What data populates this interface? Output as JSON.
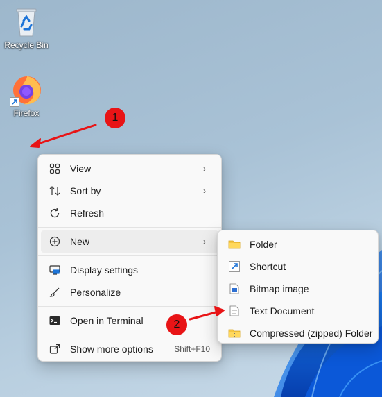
{
  "desktop": {
    "icons": [
      {
        "label": "Recycle Bin",
        "icon": "recycle-bin-icon"
      },
      {
        "label": "Firefox",
        "icon": "firefox-icon"
      }
    ]
  },
  "context_menu": {
    "items": [
      {
        "label": "View",
        "icon": "grid-view-icon",
        "has_submenu": true
      },
      {
        "label": "Sort by",
        "icon": "sort-icon",
        "has_submenu": true
      },
      {
        "label": "Refresh",
        "icon": "refresh-icon"
      },
      {
        "label": "New",
        "icon": "plus-circle-icon",
        "has_submenu": true,
        "highlighted": true
      },
      {
        "label": "Display settings",
        "icon": "display-icon"
      },
      {
        "label": "Personalize",
        "icon": "brush-icon"
      },
      {
        "label": "Open in Terminal",
        "icon": "terminal-icon"
      },
      {
        "label": "Show more options",
        "icon": "share-icon",
        "shortcut": "Shift+F10"
      }
    ]
  },
  "new_submenu": {
    "items": [
      {
        "label": "Folder",
        "icon": "folder-icon"
      },
      {
        "label": "Shortcut",
        "icon": "shortcut-icon"
      },
      {
        "label": "Bitmap image",
        "icon": "bitmap-icon"
      },
      {
        "label": "Text Document",
        "icon": "text-document-icon"
      },
      {
        "label": "Compressed (zipped) Folder",
        "icon": "zip-folder-icon"
      }
    ]
  },
  "annotations": {
    "badge1": "1",
    "badge2": "2",
    "color": "#e81416"
  }
}
